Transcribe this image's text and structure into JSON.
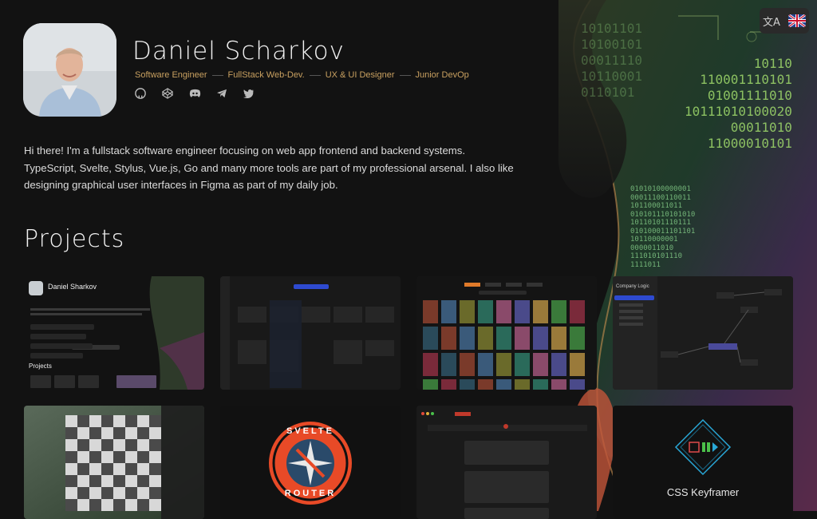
{
  "header": {
    "name": "Daniel Scharkov",
    "roles": [
      "Software Engineer",
      "FullStack Web-Dev.",
      "UX & UI Designer",
      "Junior DevOp"
    ],
    "socials": [
      "github-icon",
      "codepen-icon",
      "discord-icon",
      "telegram-icon",
      "twitter-icon"
    ]
  },
  "language_switcher": {
    "translate_icon": "文A",
    "flag": "uk-flag-icon"
  },
  "bio": "Hi there! I'm a fullstack software engineer focusing on web app frontend and backend systems. TypeScript, Svelte, Stylus, Vue.js, Go and many more tools are part of my professional arsenal. I also like designing graphical user interfaces in Figma as part of my daily job.",
  "projects": {
    "title": "Projects",
    "items": [
      {
        "thumb": "portfolio",
        "name": "Daniel Sharkov",
        "label": "Projects"
      },
      {
        "thumb": "calendar"
      },
      {
        "thumb": "movie-library"
      },
      {
        "thumb": "company-logic-editor",
        "label": "Company Logic"
      },
      {
        "thumb": "chess"
      },
      {
        "thumb": "svelte-router",
        "top": "SVELTE",
        "bottom": "ROUTER"
      },
      {
        "thumb": "dark-chat-app"
      },
      {
        "thumb": "css-keyframer",
        "label": "CSS Keyframer"
      }
    ]
  },
  "binary": {
    "a": "10101101\n10100101\n00011110\n10110001\n0110101",
    "b": "10110\n110001110101\n01001111010\n10111010100020\n00011010\n11000010101",
    "c": "01010100000001\n00011100110011\n101100011011\n010101110101010\n10110101110111\n010100011101101\n10110000001\n0000011010\n111010101110\n1111011"
  },
  "colors": {
    "accent": "#c8a060",
    "bg": "#121212"
  }
}
